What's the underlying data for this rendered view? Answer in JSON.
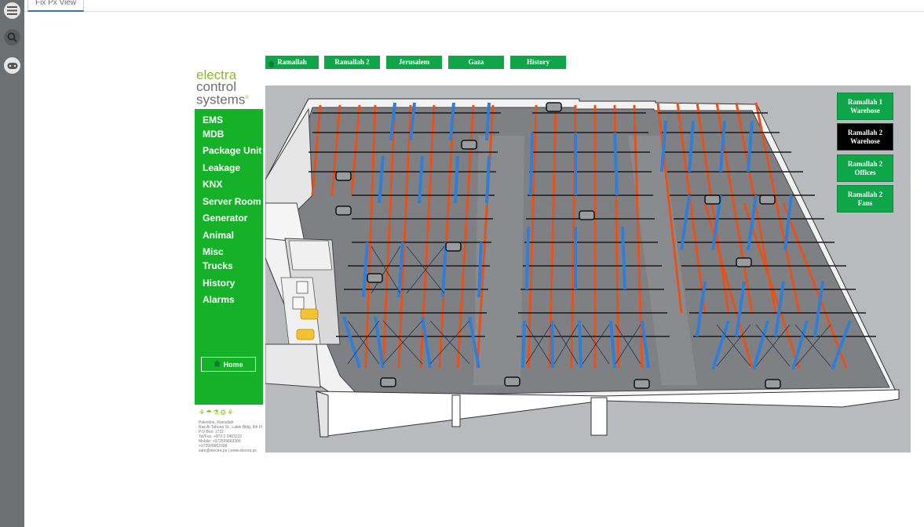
{
  "tab": {
    "label": "Fix Px View"
  },
  "rail": {
    "icons": [
      "menu-icon",
      "search-icon",
      "gamepad-icon"
    ]
  },
  "site_buttons": [
    "Ramallah",
    "Ramallah 2",
    "Jerusalem",
    "Gaza",
    "History"
  ],
  "logo": {
    "line1": "electra",
    "line2": "control",
    "line3": "systems",
    "mark": "®"
  },
  "menu": {
    "items": [
      "EMS",
      "MDB",
      "Package Unit",
      "Leakage",
      "KNX",
      "Server Room",
      "Generator",
      "Animal",
      "Misc",
      "Trucks",
      "History",
      "Alarms"
    ],
    "home_label": "Home"
  },
  "contact": {
    "lines": [
      "Palestine, Ramallah",
      "Ras Al Tahuna St., Lalek Bldg, 6th Fl.",
      "P.O Box: 1722",
      "Tel/Fax:    +972 2 2403222",
      "Mobile:     +972599663306",
      "             +972599663308",
      "sam@electra.ps | www.electra.ps"
    ]
  },
  "side_buttons": [
    {
      "line1": "Ramallah 1",
      "line2": "Warehose",
      "active": false
    },
    {
      "line1": "Ramallah 2",
      "line2": "Warehose",
      "active": true
    },
    {
      "line1": "Ramallah 2",
      "line2": "Offices",
      "active": false
    },
    {
      "line1": "Ramallah 2",
      "line2": "Fans",
      "active": false
    }
  ],
  "colors": {
    "rail": "#6d7073",
    "menu_green": "#15b229",
    "button_green": "#0fa64a",
    "active_button": "#000000",
    "rack_orange": "#e5531c",
    "rack_blue": "#2f7fd8",
    "floor": "#7f8083",
    "wall": "#f2f2f2"
  }
}
